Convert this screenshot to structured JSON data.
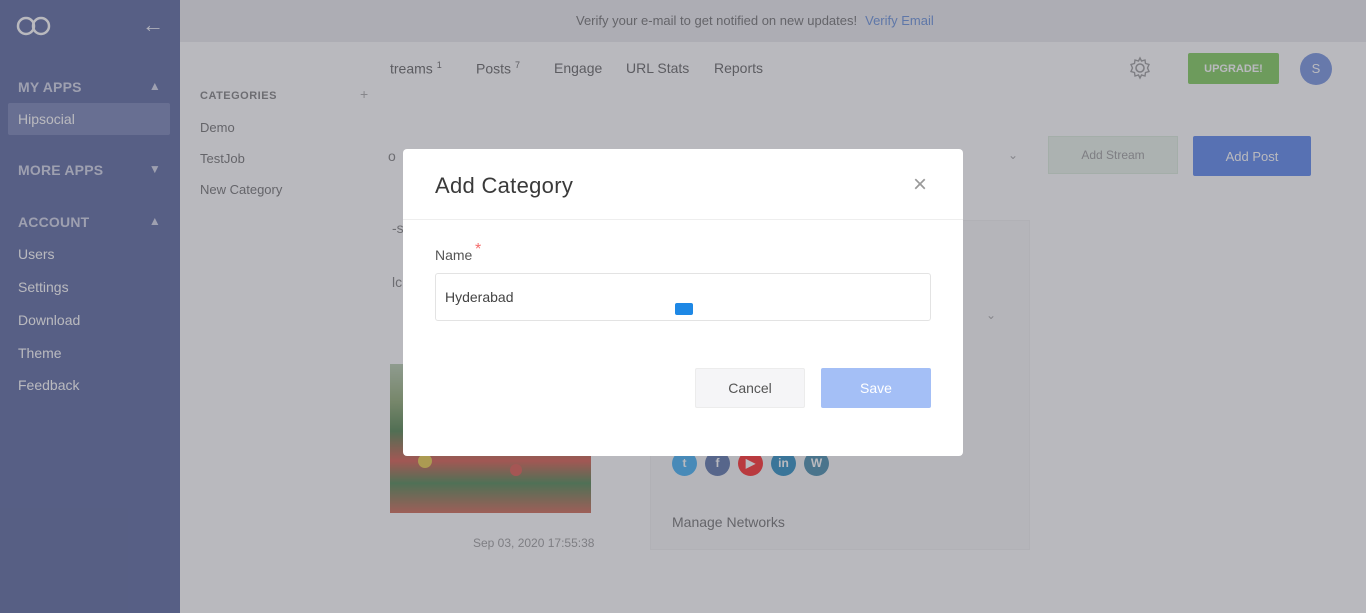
{
  "sidebar": {
    "sections": [
      {
        "label": "MY APPS",
        "chevron": "up"
      },
      {
        "label": "MORE APPS",
        "chevron": "down"
      },
      {
        "label": "ACCOUNT",
        "chevron": "up"
      }
    ],
    "active_app": "Hipsocial",
    "account_items": [
      "Users",
      "Settings",
      "Download",
      "Theme",
      "Feedback"
    ]
  },
  "topbar": {
    "message": "Verify your e-mail to get notified on new updates!",
    "verify_link": "Verify Email"
  },
  "nav": {
    "tabs": [
      {
        "label": "treams",
        "count": "1"
      },
      {
        "label": "Posts",
        "count": "7"
      },
      {
        "label": "Engage",
        "count": ""
      },
      {
        "label": "URL Stats",
        "count": ""
      },
      {
        "label": "Reports",
        "count": ""
      }
    ],
    "upgrade_label": "UPGRADE!",
    "avatar_initial": "S"
  },
  "categories": {
    "title": "CATEGORIES",
    "add_symbol": "+",
    "items": [
      "Demo",
      "TestJob",
      "New Category"
    ]
  },
  "actions": {
    "add_stream": "Add Stream",
    "add_post": "Add Post"
  },
  "fragments": {
    "frag1": "o",
    "frag2": "-s",
    "frag3": "lc"
  },
  "post": {
    "date": "Sep 03, 2020 17:55:38",
    "manage_networks": "Manage Networks"
  },
  "modal": {
    "title": "Add Category",
    "close_symbol": "×",
    "name_label": "Name",
    "required_mark": "*",
    "name_value": "Hyderabad",
    "cancel_label": "Cancel",
    "save_label": "Save"
  },
  "colors": {
    "sidebar_bg": "#3a4a8c",
    "primary": "#3a6ee8",
    "upgrade": "#67c23a",
    "required": "#f56c6c"
  }
}
